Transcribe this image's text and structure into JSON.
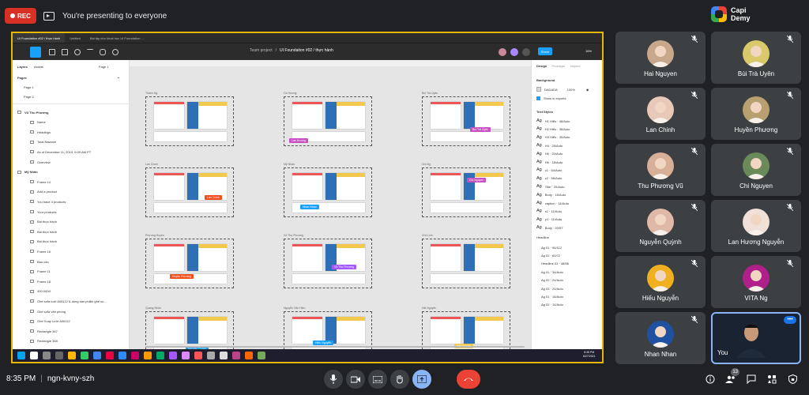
{
  "header": {
    "rec_label": "REC",
    "presenting_text": "You're presenting to everyone",
    "logo_line1": "Capi",
    "logo_line2": "Demy"
  },
  "figma": {
    "tabs": [
      "UI Foundation #02 / thực hành",
      "Untitled",
      "Bài tập cho khoá học UI Foundation ..."
    ],
    "project": "Team project",
    "doc_title": "UI Foundation #02 / thực hành",
    "share_label": "Share",
    "zoom": "16%",
    "left_tabs": {
      "layers": "Layers",
      "assets": "Assets",
      "page": "Page 1"
    },
    "pages_heading": "Pages",
    "pages": [
      "Page 1",
      "Page 2"
    ],
    "layers": [
      "Vũ Thu Phương",
      "Name",
      "Headings",
      "Total Balance",
      "As of December 11, 2019, 9:00 AM PT",
      "Overview",
      "Mỹ Nhân",
      "Frame 14",
      "Add a product",
      "You have 4 products",
      "Your products",
      "Bài thực hành",
      "Bài thực hành",
      "Bài thực hành",
      "Frame 16",
      "Báo cáo",
      "Frame 11",
      "Frame 18",
      "400.000đ",
      "Ghế sofa lười A06112 & dòng sản phẩm ghế so...",
      "Ghế sofa văn phòng",
      "Ghế Xoay Lười A06112",
      "Rectangle 367",
      "Rectangle 368"
    ],
    "frames": [
      "Thành Ng",
      "Cà Hương",
      "Bùi Trà Uyên",
      "Lan Chinh",
      "Mỹ Nhân",
      "Chi Ng",
      "Phương Huyền",
      "Vũ Thu Phương",
      "Chồ Linh",
      "Quang Nhân",
      "Nguyễn Văn Hiếu",
      "Hải Nguyên"
    ],
    "cursor_tags": [
      "Lan Hương",
      "Bùi Trà Uyên",
      "Lan Chinh",
      "Nhan Nhan",
      "Chi Nguyen",
      "Huyền Phương",
      "Vũ Thu Phương",
      "Nguyễn Quỳnh",
      "Hiếu Nguyễn",
      "Hải Nguyen"
    ],
    "right_tabs": {
      "design": "Design",
      "prototype": "Prototype",
      "inspect": "Inspect"
    },
    "background_heading": "Background",
    "bg_hex": "DADADA",
    "bg_opacity": "100%",
    "show_exports": "Show in exports",
    "text_styles_heading": "Text Styles",
    "text_styles": [
      "H1 Hiểu · 48/Auto",
      "H2 Hiểu · 36/Auto",
      "H3 Hiểu · 30/Auto",
      "H4 · 25/Auto",
      "H5 · 20/Auto",
      "H6 · 18/Auto",
      "c1 · 64/Auto",
      "c2 · 56/Auto",
      "Title · 20/Auto",
      "Body · 16/Auto",
      "caption · 14/Auto",
      "s1 · 11/Auto",
      "p1 · 11/Auto",
      "Body · 20/57"
    ],
    "headline_heading": "Headline",
    "headlines": [
      "Ag 01 · 96/112",
      "Ag 02 · 60/72",
      "Headline 03 · 48/56",
      "Ag 01 · 34/Auto",
      "Ag 02 · 24/Auto",
      "Ag 03 · 20/Auto",
      "Ag 01 · 16/Auto",
      "Ag 02 · 14/Auto"
    ],
    "help_label": "?",
    "clock_time": "8:35 PM",
    "clock_date": "6/27/2021"
  },
  "participants": [
    {
      "name": "Hai Nguyen",
      "color": "#c8a88a"
    },
    {
      "name": "Bùi Trà Uyên",
      "color": "#d9c96a"
    },
    {
      "name": "Lan Chinh",
      "color": "#e8c8b8"
    },
    {
      "name": "Huyền Phương",
      "color": "#b8a070"
    },
    {
      "name": "Thu Phương Vũ",
      "color": "#d8b098"
    },
    {
      "name": "Chi Nguyen",
      "color": "#6a8a5a"
    },
    {
      "name": "Nguyễn Quỳnh",
      "color": "#e0b8a8"
    },
    {
      "name": "Lan Hương Nguyễn",
      "color": "#f0e0d8"
    },
    {
      "name": "Hiếu Nguyễn",
      "color": "#f0b020"
    },
    {
      "name": "VITA Ng",
      "color": "#b0208a"
    },
    {
      "name": "Nhan Nhan",
      "color": "#2050a0"
    },
    {
      "name": "You",
      "color": "#3a6aa0"
    }
  ],
  "bottom": {
    "time": "8:35 PM",
    "separator": "|",
    "meeting_code": "ngn-kvny-szh",
    "people_count": "13"
  }
}
